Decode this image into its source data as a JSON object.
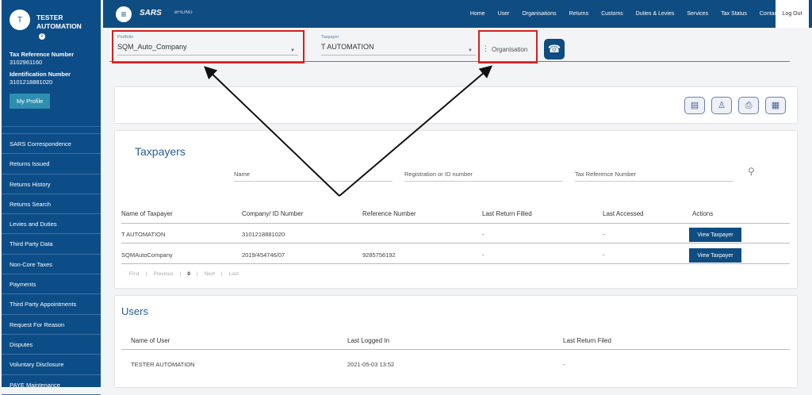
{
  "sidebar": {
    "avatar_initial": "T",
    "user_name": "TESTER AUTOMATION",
    "tax_ref_label": "Tax Reference Number",
    "tax_ref": "3102961160",
    "id_label": "Identification Number",
    "id_number": "3101218881020",
    "profile_button": "My Profile",
    "items": [
      "SARS Correspondence",
      "Returns Issued",
      "Returns History",
      "Returns Search",
      "Levies and Duties",
      "Third Party Data",
      "Non-Core Taxes",
      "Payments",
      "Third Party Appointments",
      "Request For Reason",
      "Disputes",
      "Voluntary Disclosure",
      "PAYE Maintenance"
    ]
  },
  "topbar": {
    "logo": "SARS",
    "logo_sub": "eFILING",
    "nav": [
      "Home",
      "User",
      "Organisations",
      "Returns",
      "Customs",
      "Duties & Levies",
      "Services",
      "Tax Status",
      "Contact"
    ],
    "logout": "Log Out"
  },
  "filters": {
    "portfolio_label": "Portfolio",
    "portfolio_value": "SQM_Auto_Company",
    "taxpayer_label": "Taxpayer",
    "taxpayer_value": "T AUTOMATION",
    "organisation": "Organisation"
  },
  "taxpayers": {
    "title": "Taxpayers",
    "search": {
      "name": "Name",
      "reg": "Registration or ID number",
      "taxref": "Tax Reference Number"
    },
    "columns": [
      "Name of Taxpayer",
      "Company/ ID Number",
      "Reference Number",
      "Last Return Filled",
      "Last Accessed",
      "Actions"
    ],
    "rows": [
      {
        "name": "T AUTOMATION",
        "company": "3101218881020",
        "ref": "",
        "last_return": "-",
        "last_accessed": "-",
        "action": "View Taxpayer"
      },
      {
        "name": "SQMAutoCompany",
        "company": "2019/454746/07",
        "ref": "9285756192",
        "last_return": "-",
        "last_accessed": "-",
        "action": "View Taxpayer"
      }
    ],
    "pager": {
      "first": "First",
      "previous": "Previous",
      "page": "0",
      "next": "Next",
      "last": "Last"
    }
  },
  "users": {
    "title": "Users",
    "columns": [
      "Name of User",
      "Last Logged In",
      "Last Return Filed"
    ],
    "rows": [
      {
        "name": "TESTER AUTOMATION",
        "logged": "2021-05-03 13:52",
        "last_return": "-"
      }
    ]
  },
  "colors": {
    "primary": "#0f4c81",
    "highlight": "#d42020"
  }
}
